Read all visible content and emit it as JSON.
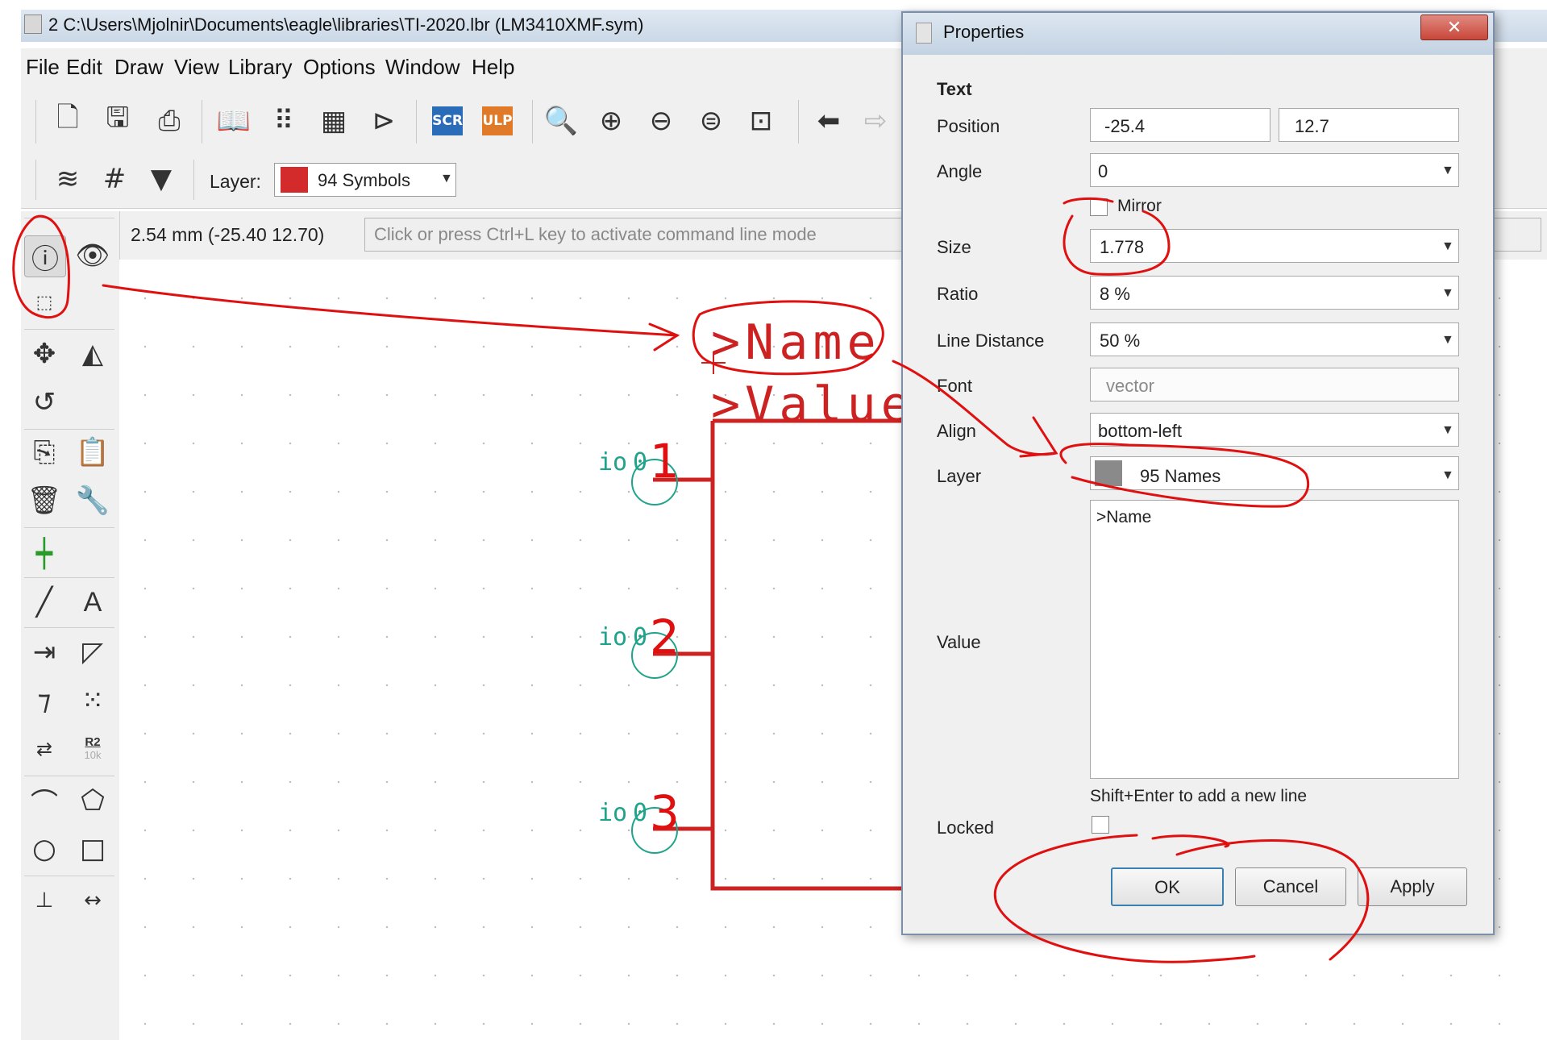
{
  "window": {
    "title": "2 C:\\Users\\Mjolnir\\Documents\\eagle\\libraries\\TI-2020.lbr (LM3410XMF.sym)"
  },
  "menu": [
    "File",
    "Edit",
    "Draw",
    "View",
    "Library",
    "Options",
    "Window",
    "Help"
  ],
  "toolbar": {
    "scr_label": "SCR",
    "ulp_label": "ULP",
    "layer_label": "Layer:",
    "layer_value": "94 Symbols",
    "layer_color": "#d32b2b"
  },
  "status": {
    "coords": "2.54 mm (-25.40 12.70)",
    "command_placeholder": "Click or press Ctrl+L key to activate command line mode"
  },
  "toolbox": {
    "r2_label": "R2",
    "r2_value": "10k"
  },
  "schematic": {
    "name_text": ">Name",
    "value_text": ">Value",
    "pins": [
      {
        "label": "io",
        "number": "1"
      },
      {
        "label": "io",
        "number": "2"
      },
      {
        "label": "io",
        "number": "3"
      }
    ],
    "pin_zero": "0",
    "symbol_color": "#cc2222",
    "pin_color": "#1fa38a"
  },
  "dialog": {
    "title": "Properties",
    "close": "✕",
    "section": "Text",
    "position_label": "Position",
    "position_x": "-25.4",
    "position_y": "12.7",
    "angle_label": "Angle",
    "angle_value": "0",
    "mirror_label": "Mirror",
    "size_label": "Size",
    "size_value": "1.778",
    "ratio_label": "Ratio",
    "ratio_value": "8 %",
    "line_distance_label": "Line Distance",
    "line_distance_value": "50 %",
    "font_label": "Font",
    "font_placeholder": "vector",
    "align_label": "Align",
    "align_value": "bottom-left",
    "layer_label": "Layer",
    "layer_value": "95 Names",
    "layer_color": "#8a8a8a",
    "value_label": "Value",
    "value_text": ">Name",
    "value_hint": "Shift+Enter to add a new line",
    "locked_label": "Locked",
    "ok": "OK",
    "cancel": "Cancel",
    "apply": "Apply"
  },
  "annotation_color": "#e01010"
}
